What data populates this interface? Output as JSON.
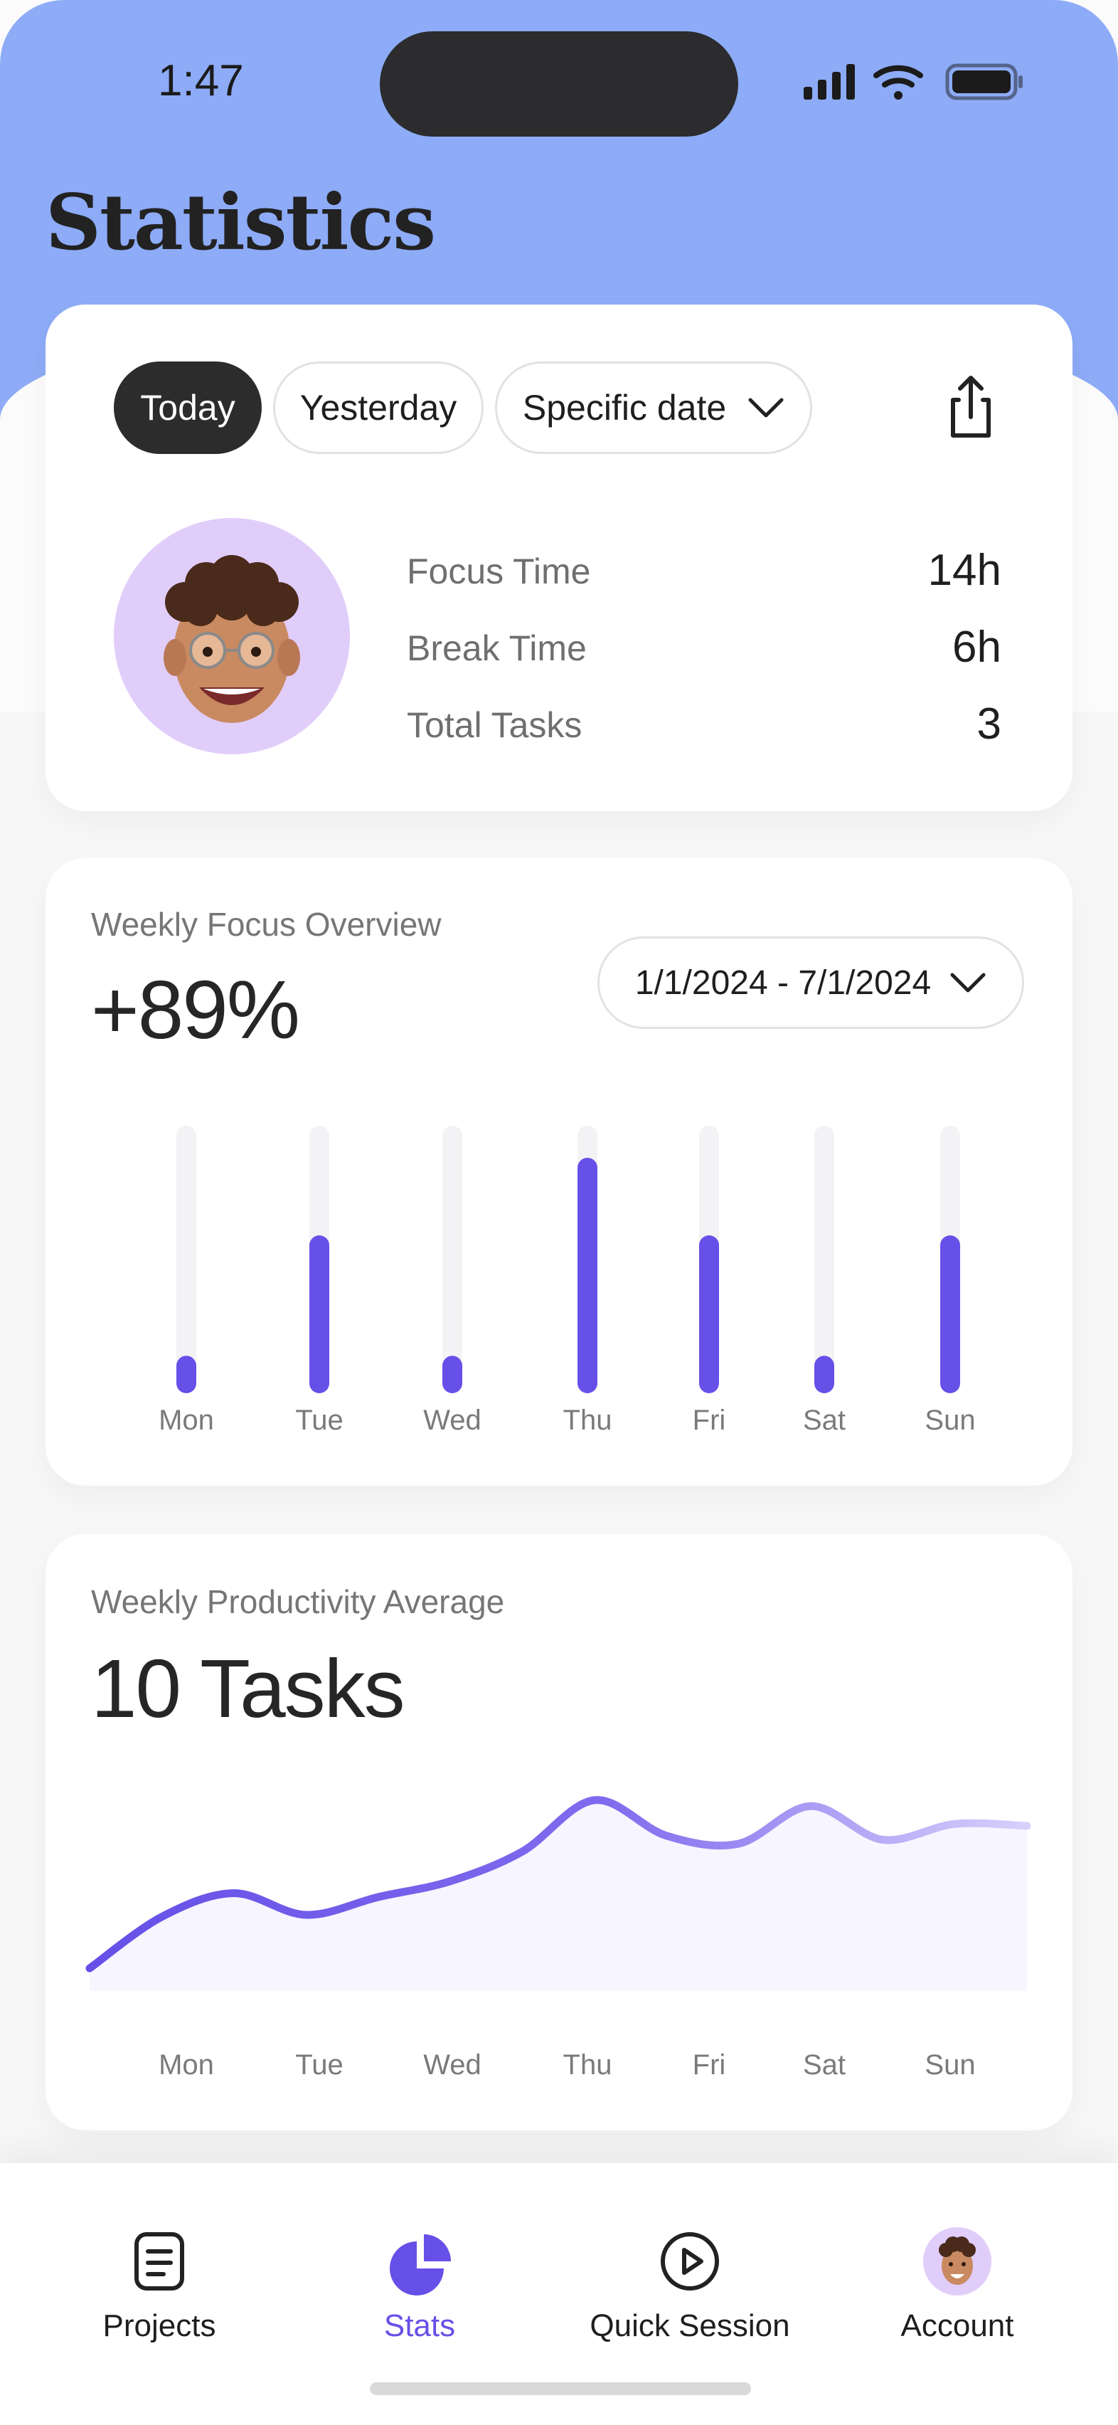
{
  "status_bar": {
    "time": "1:47"
  },
  "header": {
    "title": "Statistics"
  },
  "filters": {
    "today": "Today",
    "yesterday": "Yesterday",
    "specific_date": "Specific date",
    "selected": "Today"
  },
  "summary": {
    "focus_time_label": "Focus Time",
    "focus_time_value": "14h",
    "break_time_label": "Break Time",
    "break_time_value": "6h",
    "total_tasks_label": "Total Tasks",
    "total_tasks_value": "3"
  },
  "weekly_focus": {
    "label": "Weekly Focus Overview",
    "value": "+89%",
    "date_range": "1/1/2024 - 7/1/2024"
  },
  "weekly_productivity": {
    "label": "Weekly Productivity Average",
    "value": "10 Tasks"
  },
  "chart_data": [
    {
      "type": "bar",
      "categories": [
        "Mon",
        "Tue",
        "Wed",
        "Thu",
        "Fri",
        "Sat",
        "Sun"
      ],
      "values": [
        0.14,
        0.59,
        0.14,
        0.88,
        0.59,
        0.14,
        0.59
      ],
      "ylim": [
        0,
        1
      ],
      "grid": false
    },
    {
      "type": "area",
      "categories": [
        "Mon",
        "Tue",
        "Wed",
        "Thu",
        "Fri",
        "Sat",
        "Sun"
      ],
      "x": [
        0,
        0.5,
        1,
        1.5,
        2,
        2.5,
        3,
        3.5,
        4,
        4.5,
        5,
        5.5,
        6,
        6.5
      ],
      "values": [
        0.1,
        0.36,
        0.48,
        0.37,
        0.46,
        0.54,
        0.69,
        0.95,
        0.77,
        0.73,
        0.92,
        0.75,
        0.83,
        0.82
      ],
      "ylim": [
        0,
        1
      ],
      "grid": false
    }
  ],
  "tabbar": {
    "items": [
      {
        "label": "Projects",
        "icon": "document-icon"
      },
      {
        "label": "Stats",
        "icon": "pie-chart-icon"
      },
      {
        "label": "Quick Session",
        "icon": "play-circle-icon"
      },
      {
        "label": "Account",
        "icon": "avatar-icon"
      }
    ],
    "active": "Stats"
  },
  "colors": {
    "header_blue": "#8dabf6",
    "accent": "#6650e8",
    "chip_dark": "#2c2c2c",
    "avatar_bg": "#e1cdfa",
    "track": "#f3f3f5"
  }
}
